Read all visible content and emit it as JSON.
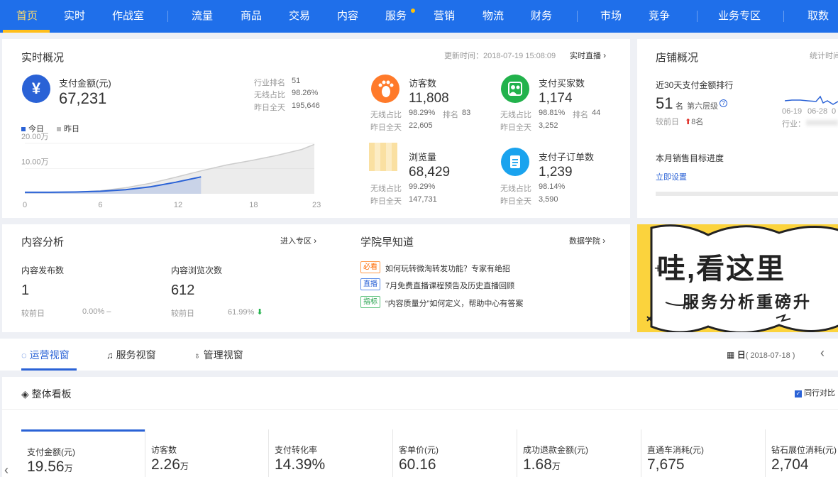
{
  "nav": {
    "items": [
      "首页",
      "实时",
      "作战室",
      "流量",
      "商品",
      "交易",
      "内容",
      "服务",
      "营销",
      "物流",
      "财务",
      "市场",
      "竞争",
      "业务专区",
      "取数"
    ]
  },
  "realtime": {
    "title": "实时概况",
    "update_time": "更新时间：2018-07-19 15:08:09",
    "live_link": "实时直播",
    "pay": {
      "label": "支付金额(元)",
      "value": "67,231",
      "rank_label": "行业排名",
      "rank_value": "51",
      "wireless_label": "无线占比",
      "wireless_value": "98.26%",
      "yesterday_label": "昨日全天",
      "yesterday_value": "195,646"
    },
    "legend": {
      "today": "今日",
      "yesterday": "昨日"
    },
    "metrics": [
      {
        "name": "访客数",
        "value": "11,808",
        "l1": "无线占比",
        "v1": "98.29%",
        "l2": "排名",
        "v2": "83",
        "l3": "昨日全天",
        "v3": "22,605"
      },
      {
        "name": "支付买家数",
        "value": "1,174",
        "l1": "无线占比",
        "v1": "98.81%",
        "l2": "排名",
        "v2": "44",
        "l3": "昨日全天",
        "v3": "3,252"
      },
      {
        "name": "浏览量",
        "value": "68,429",
        "l1": "无线占比",
        "v1": "99.29%",
        "l3": "昨日全天",
        "v3": "147,731"
      },
      {
        "name": "支付子订单数",
        "value": "1,239",
        "l1": "无线占比",
        "v1": "98.14%",
        "l3": "昨日全天",
        "v3": "3,590"
      }
    ]
  },
  "chart_data": {
    "type": "area",
    "xticks": [
      "0",
      "6",
      "12",
      "18",
      "23"
    ],
    "yticks": [
      "20.00万",
      "10.00万"
    ],
    "x": [
      0,
      2,
      4,
      6,
      8,
      10,
      12,
      14,
      16,
      18,
      20,
      22,
      23
    ],
    "series": [
      {
        "name": "今日",
        "color": "#2a62d6",
        "values": [
          0.6,
          0.6,
          0.7,
          1.0,
          1.6,
          2.8,
          4.6,
          6.7
        ]
      },
      {
        "name": "昨日",
        "color": "#cccccc",
        "values": [
          0.6,
          0.6,
          0.7,
          1.2,
          2.4,
          4.2,
          6.6,
          9.1,
          11.4,
          13.2,
          15.2,
          17.6,
          19.6
        ]
      }
    ],
    "ylim": [
      0,
      20
    ]
  },
  "store": {
    "title": "店铺概况",
    "stat_time": "统计时间",
    "rank_title": "近30天支付金额排行",
    "rank_value": "51",
    "rank_unit": "名",
    "rank_level": "第六层级",
    "compare_label": "较前日",
    "compare_change": "8名",
    "date_ticks": [
      "06-19",
      "06-28",
      "0"
    ],
    "industry_label": "行业：",
    "target_title": "本月销售目标进度",
    "target_link": "立即设置"
  },
  "content": {
    "title": "内容分析",
    "link": "进入专区",
    "publish_label": "内容发布数",
    "publish_value": "1",
    "publish_compare_label": "较前日",
    "publish_compare_value": "0.00% –",
    "views_label": "内容浏览次数",
    "views_value": "612",
    "views_compare_label": "较前日",
    "views_compare_value": "61.99%"
  },
  "academy": {
    "title": "学院早知道",
    "link": "数据学院",
    "items": [
      {
        "tag": "必看",
        "text": "如何玩转微淘转发功能？专家有绝招"
      },
      {
        "tag": "直播",
        "text": "7月免费直播课程预告及历史直播回顾"
      },
      {
        "tag": "指标",
        "text": "“内容质量分”如何定义，帮助中心有答案"
      }
    ]
  },
  "banner": {
    "line1": "哇,看这里",
    "line2": "服务分析重磅升"
  },
  "tabs": [
    "运营视窗",
    "服务视窗",
    "管理视窗"
  ],
  "date": {
    "unit": "日",
    "value": "( 2018-07-18 )"
  },
  "board": {
    "title": "整体看板",
    "compare": "同行对比",
    "kpis": [
      {
        "label": "支付金额(元)",
        "value": "19.56",
        "unit": "万"
      },
      {
        "label": "访客数",
        "value": "2.26",
        "unit": "万"
      },
      {
        "label": "支付转化率",
        "value": "14.39%",
        "unit": ""
      },
      {
        "label": "客单价(元)",
        "value": "60.16",
        "unit": ""
      },
      {
        "label": "成功退款金额(元)",
        "value": "1.68",
        "unit": "万"
      },
      {
        "label": "直通车消耗(元)",
        "value": "7,675",
        "unit": ""
      },
      {
        "label": "钻石展位消耗(元)",
        "value": "2,704",
        "unit": ""
      }
    ]
  },
  "colors": {
    "nav": "#1f6fea",
    "accent": "#ffbe1a",
    "primary": "#2a62d6"
  }
}
